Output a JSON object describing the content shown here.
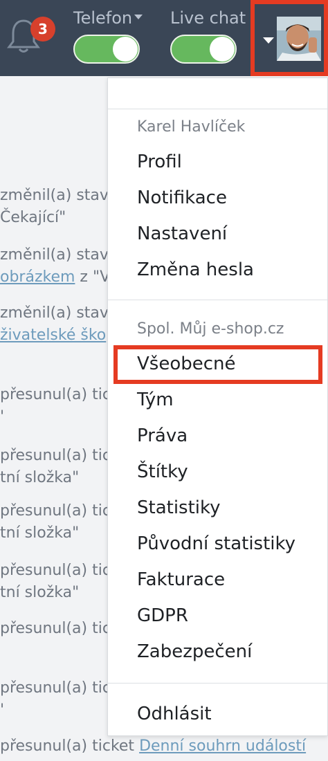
{
  "header": {
    "notifications_count": "3",
    "telefon_label": "Telefon",
    "livechat_label": "Live chat",
    "telefon_on": true,
    "livechat_on": true,
    "highlight_color": "#e53b22",
    "bar_color": "#3a4656",
    "toggle_color": "#66b85e"
  },
  "background_lines": [
    {
      "text": "změnil(a) stav",
      "link": ""
    },
    {
      "text": "Čekající\"",
      "link": ""
    },
    {
      "text": "změnil(a) stav",
      "link": ""
    },
    {
      "text": " z \"Vy",
      "link": "obrázkem"
    },
    {
      "text": "změnil(a) stav",
      "link": ""
    },
    {
      "text": "",
      "link": "živatelské ško"
    },
    {
      "text": "přesunul(a) tic",
      "link": ""
    },
    {
      "text": "'",
      "link": ""
    },
    {
      "text": "přesunul(a) tic",
      "link": ""
    },
    {
      "text": "tní složka\"",
      "link": ""
    },
    {
      "text": "přesunul(a) tic",
      "link": ""
    },
    {
      "text": "tní složka\"",
      "link": ""
    },
    {
      "text": "přesunul(a) tic",
      "link": ""
    },
    {
      "text": "tní složka\"",
      "link": ""
    },
    {
      "text": "přesunul(a) tic",
      "link": ""
    },
    {
      "text": "přesunul(a) tic",
      "link": ""
    },
    {
      "text": "'",
      "link": ""
    },
    {
      "text": "přesunul(a) ticket ",
      "link": "Denní souhrn událostí"
    }
  ],
  "menu": {
    "user_name": "Karel Havlíček",
    "user_items": [
      "Profil",
      "Notifikace",
      "Nastavení",
      "Změna hesla"
    ],
    "company_name": "Spol. Můj e-shop.cz",
    "company_items": [
      "Všeobecné",
      "Tým",
      "Práva",
      "Štítky",
      "Statistiky",
      "Původní statistiky",
      "Fakturace",
      "GDPR",
      "Zabezpečení"
    ],
    "logout": "Odhlásit",
    "highlighted_item": "Všeobecné"
  }
}
